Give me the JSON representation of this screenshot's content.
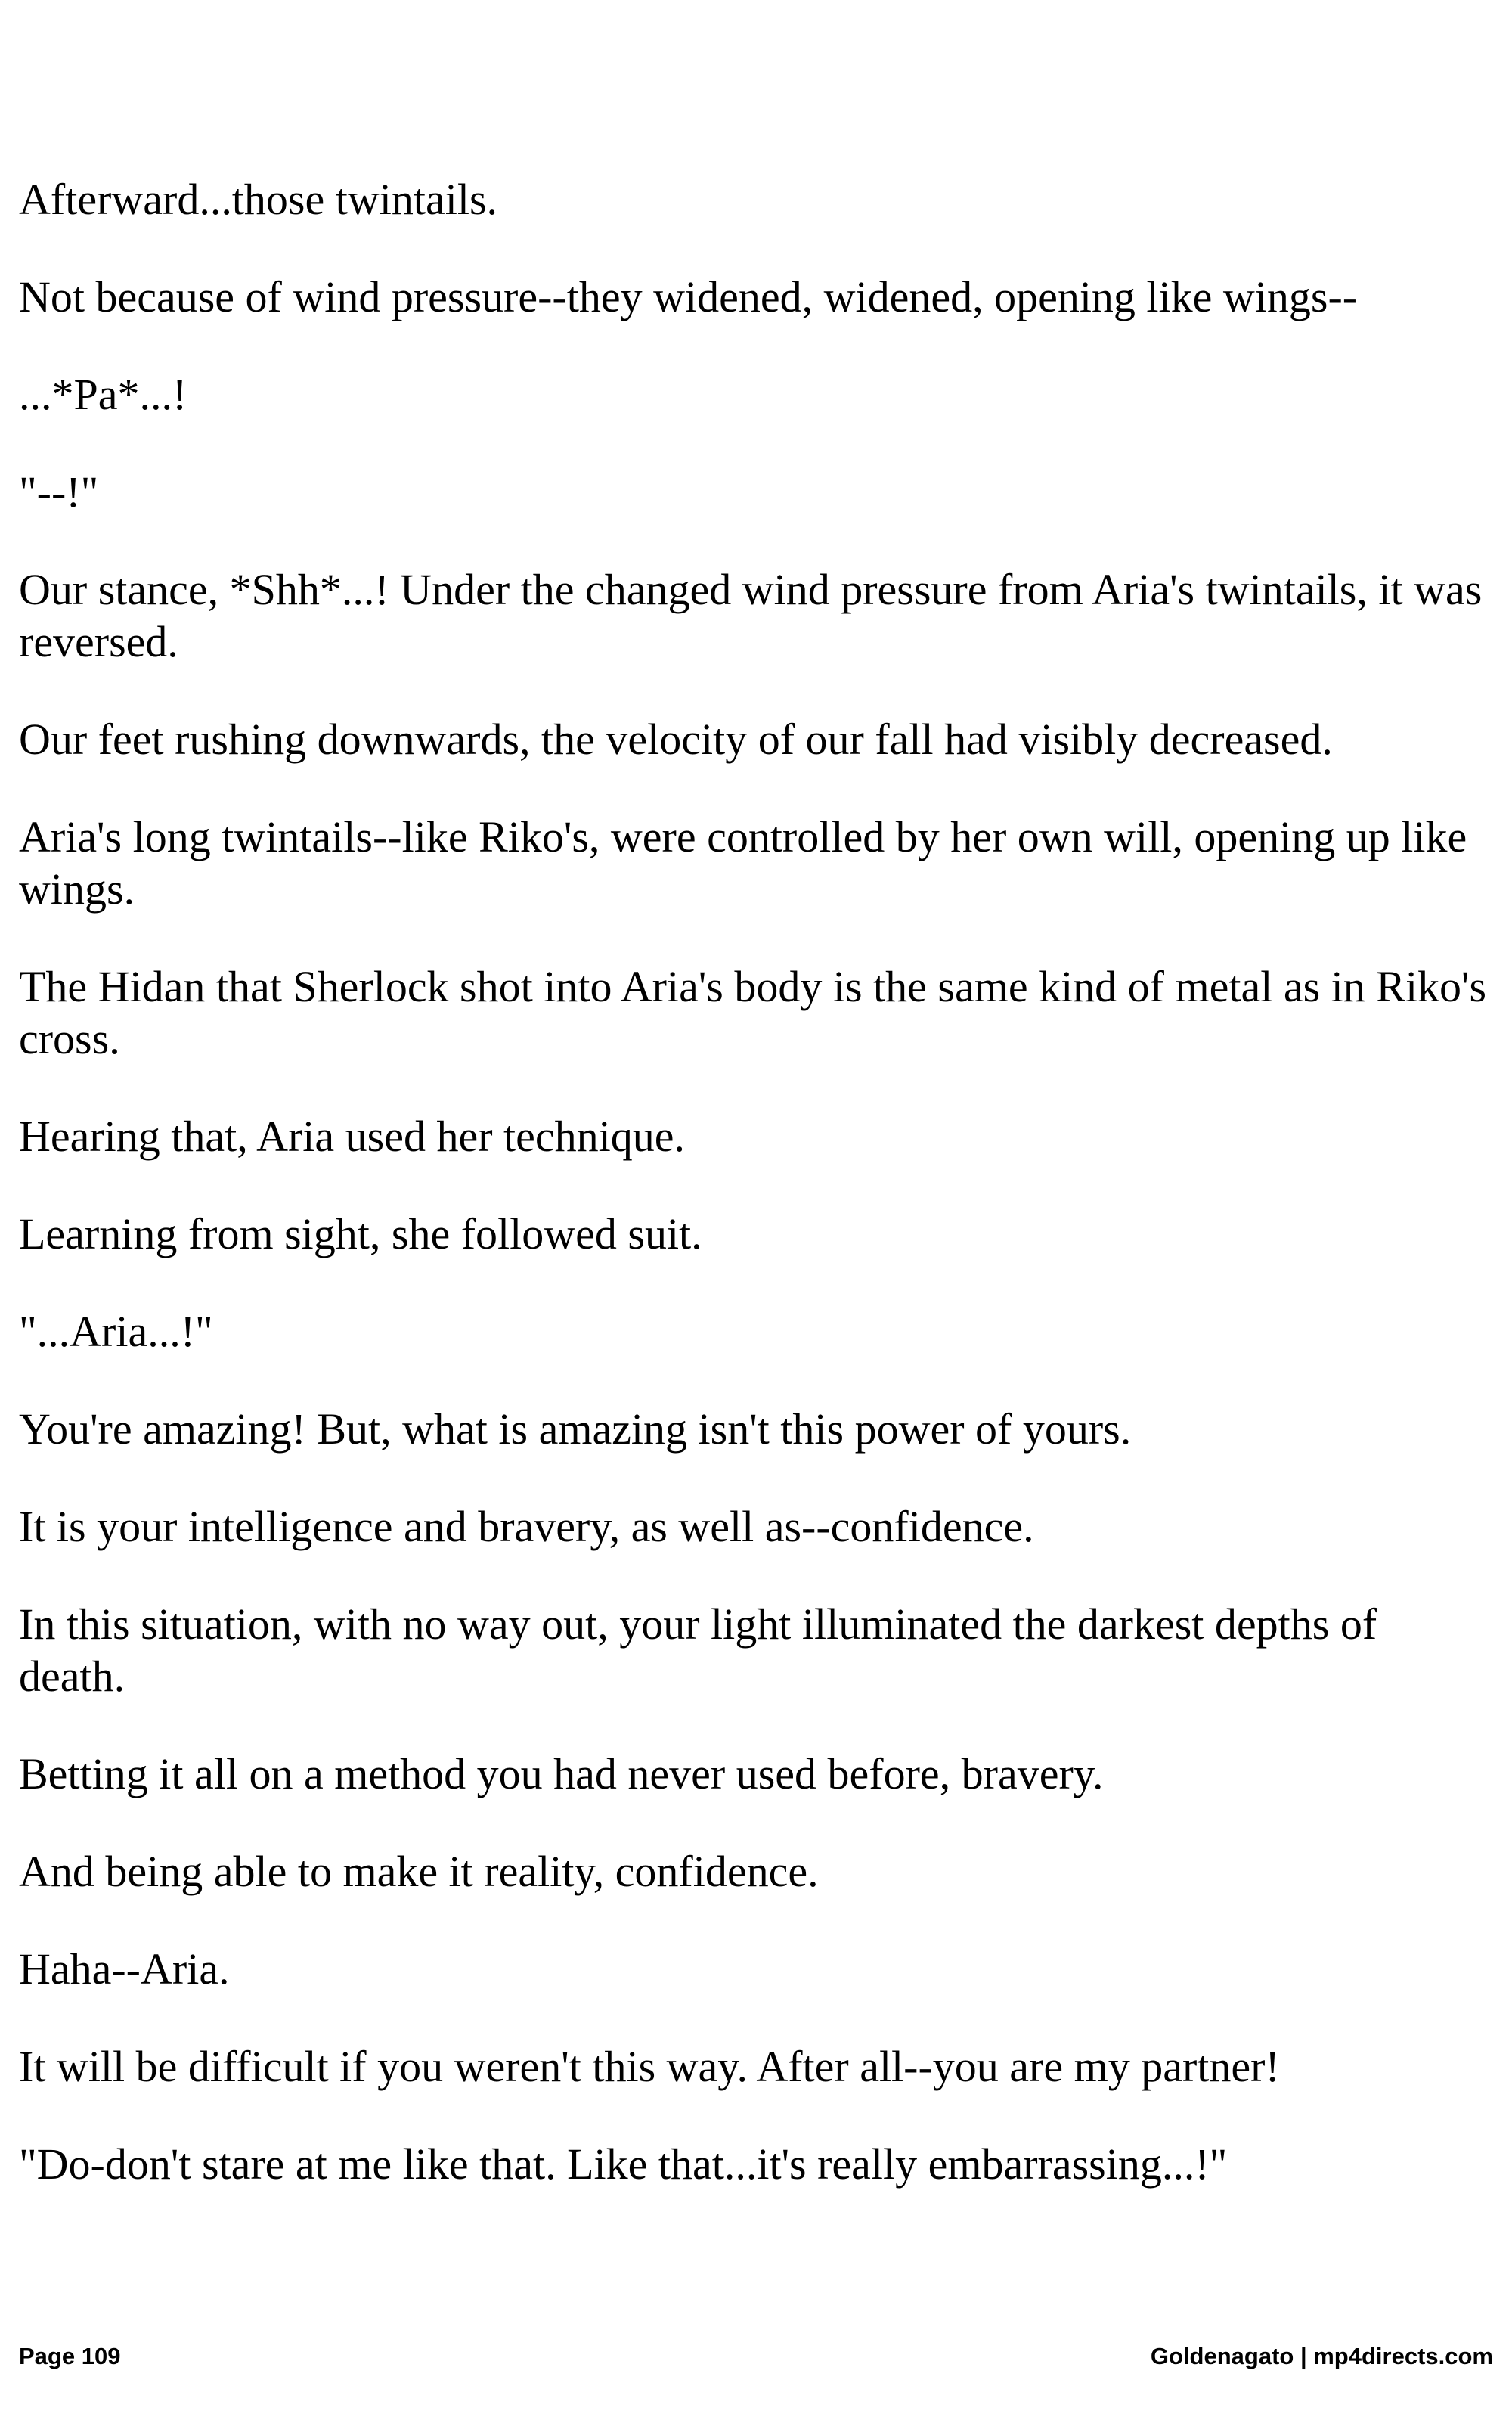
{
  "paragraphs": [
    "Afterward...those twintails.",
    "Not because of wind pressure--they widened, widened, opening like wings--",
    "...*Pa*...!",
    "\"--!\"",
    "Our stance, *Shh*...! Under the changed wind pressure from Aria's twintails, it was reversed.",
    "Our feet rushing downwards, the velocity of our fall had visibly decreased.",
    "Aria's long twintails--like Riko's, were controlled by her own will, opening up like wings.",
    "The Hidan that Sherlock shot into Aria's body is the same kind of metal as in Riko's cross.",
    "Hearing that, Aria used her technique.",
    "Learning from sight, she followed suit.",
    "\"...Aria...!\"",
    "You're amazing! But, what is amazing isn't this power of yours.",
    "It is your intelligence and bravery, as well as--confidence.",
    "In this situation, with no way out, your light illuminated the darkest depths of death.",
    "Betting it all on a method you had never used before, bravery.",
    "And being able to make it reality, confidence.",
    "Haha--Aria.",
    "It will be difficult if you weren't this way. After all--you are my partner!",
    "\"Do-don't stare at me like that. Like that...it's really embarrassing...!\""
  ],
  "footer": {
    "page": "Page 109",
    "credit": "Goldenagato | mp4directs.com"
  }
}
